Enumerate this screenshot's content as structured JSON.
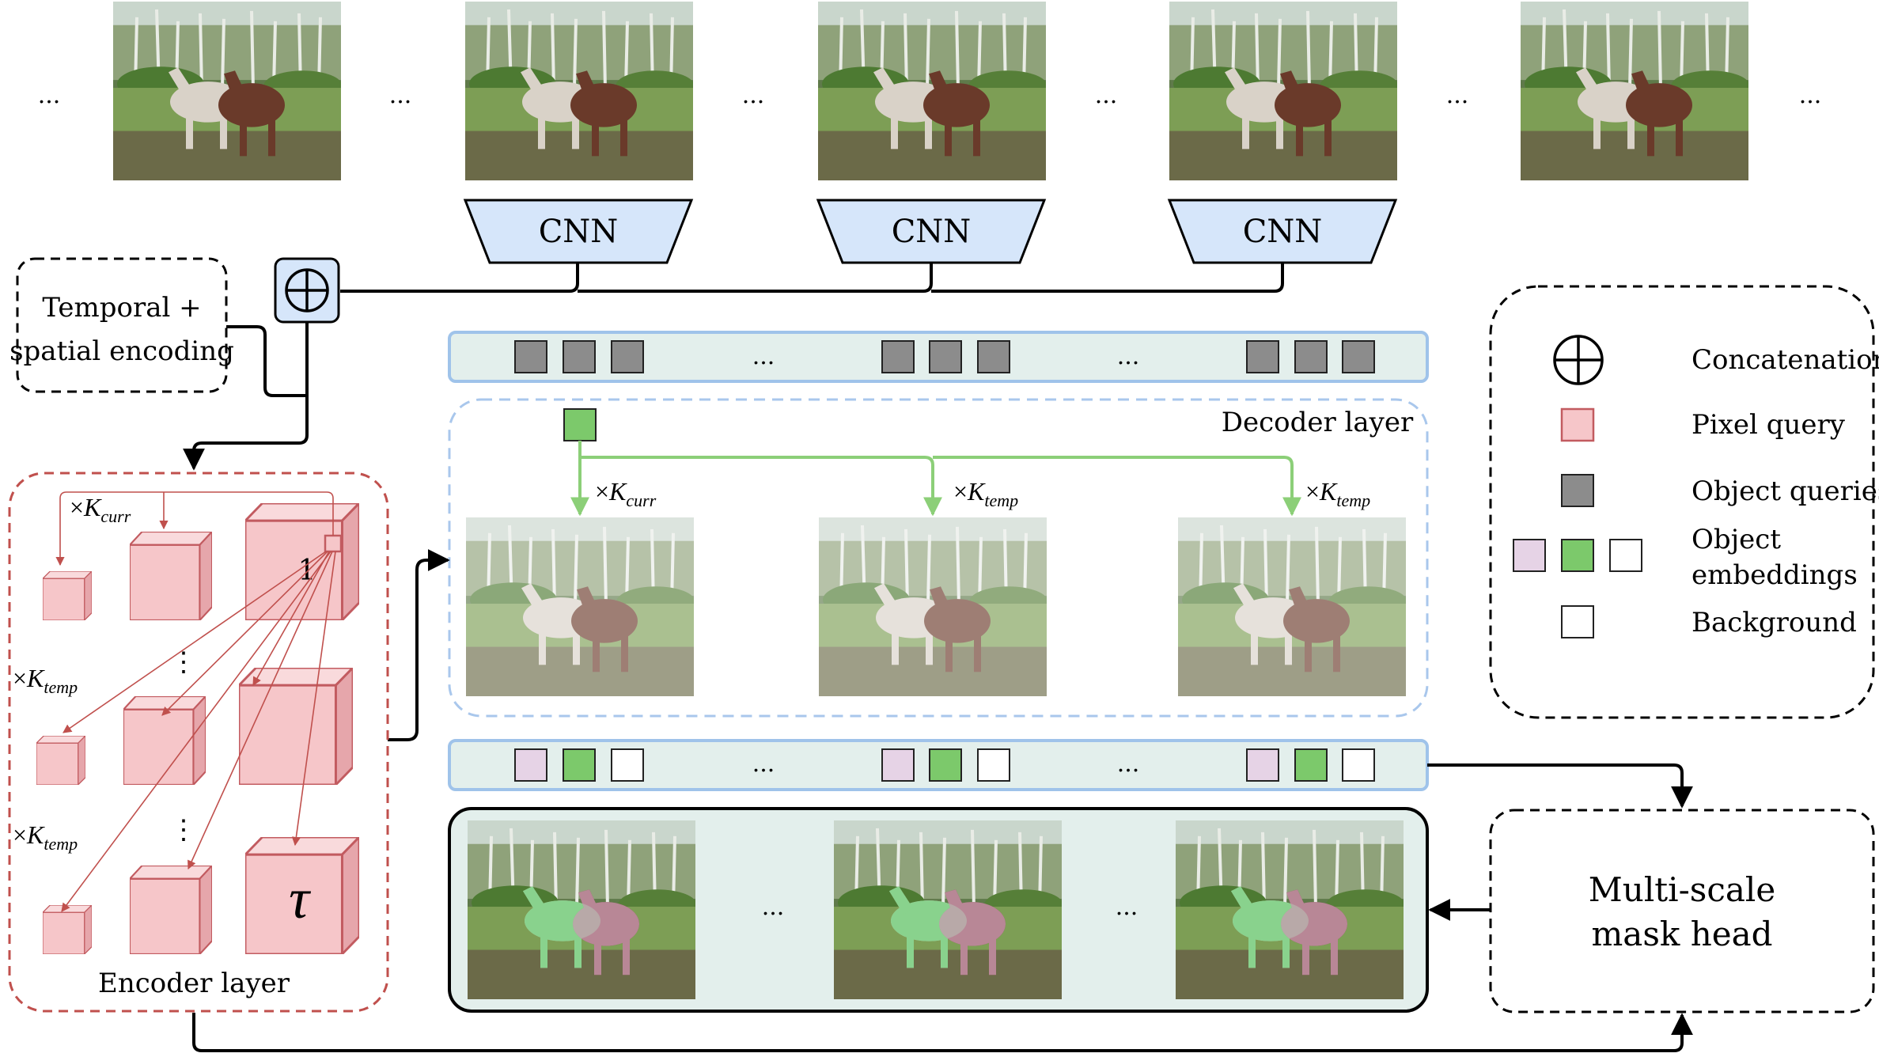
{
  "frames": {
    "ellipsis": "...",
    "count": 5
  },
  "backbone": {
    "cnn_label": "CNN",
    "count": 3
  },
  "encoding": {
    "line1": "Temporal +",
    "line2": "spatial encoding"
  },
  "queries": {
    "ellipsis": "..."
  },
  "decoder": {
    "title": "Decoder layer",
    "k_curr_prefix": "×",
    "k_curr_symbol": "K",
    "k_curr_sub": "curr",
    "k_temp_prefix": "×",
    "k_temp_symbol": "K",
    "k_temp_sub": "temp"
  },
  "encoder": {
    "title": "Encoder layer",
    "pixel_index": "1",
    "tau": "τ",
    "dots": "⋮",
    "k_curr_prefix": "×",
    "k_curr_symbol": "K",
    "k_curr_sub": "curr",
    "k_temp_prefix": "×",
    "k_temp_symbol": "K",
    "k_temp_sub": "temp"
  },
  "legend": {
    "concatenation": "Concatenation",
    "pixel_query": "Pixel query",
    "object_queries": "Object queries",
    "object_embeddings_line1": "Object",
    "object_embeddings_line2": "embeddings",
    "background": "Background"
  },
  "mask_head": {
    "line1": "Multi-scale",
    "line2": "mask head"
  },
  "output": {
    "ellipsis": "..."
  },
  "colors": {
    "cnn_fill": "#d6e6fa",
    "band_fill": "#e3efec",
    "band_stroke": "#9fc3ea",
    "query_gray": "#8c8c8c",
    "pixel_pink": "#f6c6c9",
    "pink_stroke": "#c25b60",
    "green": "#7cc96b",
    "green_line": "#8ccf78",
    "lilac": "#e6d3e6",
    "encoder_dash": "#c0504d",
    "decoder_dash": "#a9c7ec"
  }
}
